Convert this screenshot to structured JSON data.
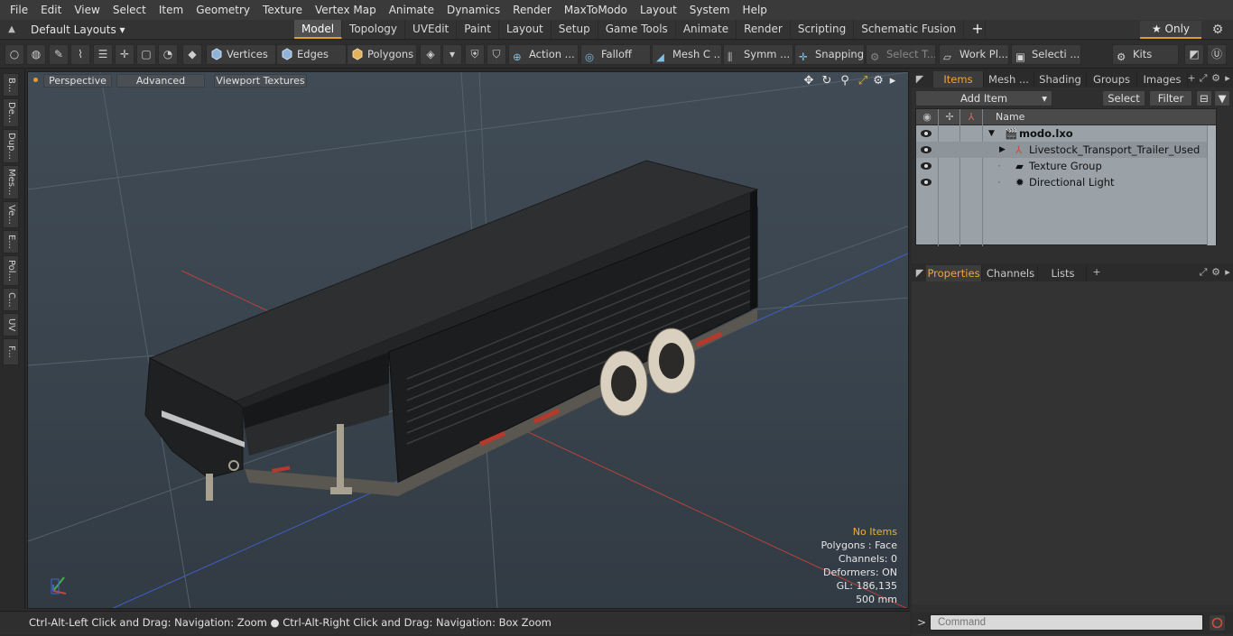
{
  "menu": [
    "File",
    "Edit",
    "View",
    "Select",
    "Item",
    "Geometry",
    "Texture",
    "Vertex Map",
    "Animate",
    "Dynamics",
    "Render",
    "MaxToModo",
    "Layout",
    "System",
    "Help"
  ],
  "layout": {
    "selector": "Default Layouts ▾"
  },
  "tabs": [
    {
      "label": "Model",
      "active": true
    },
    {
      "label": "Topology"
    },
    {
      "label": "UVEdit"
    },
    {
      "label": "Paint"
    },
    {
      "label": "Layout"
    },
    {
      "label": "Setup"
    },
    {
      "label": "Game Tools"
    },
    {
      "label": "Animate"
    },
    {
      "label": "Render"
    },
    {
      "label": "Scripting"
    },
    {
      "label": "Schematic Fusion"
    }
  ],
  "only_label": "★ Only",
  "toolbar": {
    "vertices": "Vertices",
    "edges": "Edges",
    "polygons": "Polygons",
    "action": "Action ...",
    "falloff": "Falloff",
    "mesh": "Mesh C ...",
    "symm": "Symm ...",
    "snapping": "Snapping",
    "select_t": "Select T...",
    "work_pl": "Work Pl...",
    "selecti": "Selecti ...",
    "kits": "Kits"
  },
  "left_tabs": [
    "B...",
    "De...",
    "Dup...",
    "Mes...",
    "Ve...",
    "E...",
    "Pol...",
    "C...",
    "UV",
    "F..."
  ],
  "viewport": {
    "perspective": "Perspective",
    "advanced": "Advanced",
    "viewport_textures": "Viewport Textures",
    "hud": {
      "no_items": "No Items",
      "polygons": "Polygons : Face",
      "channels": "Channels: 0",
      "deformers": "Deformers: ON",
      "gl": "GL: 186,135",
      "scale": "500 mm"
    }
  },
  "status": "Ctrl-Alt-Left Click and Drag: Navigation: Zoom ● Ctrl-Alt-Right Click and Drag: Navigation: Box Zoom",
  "items_panel": {
    "tabs": [
      "Items",
      "Mesh ...",
      "Shading",
      "Groups",
      "Images"
    ],
    "add_item": "Add Item",
    "select": "Select",
    "filter": "Filter",
    "col_name": "Name",
    "rows": [
      {
        "label": "modo.lxo"
      },
      {
        "label": "Livestock_Transport_Trailer_Used"
      },
      {
        "label": "Texture Group"
      },
      {
        "label": "Directional Light"
      }
    ]
  },
  "properties_panel": {
    "tabs": [
      "Properties",
      "Channels",
      "Lists"
    ]
  },
  "command": {
    "placeholder": "Command",
    "prompt": ">"
  },
  "colors": {
    "accent": "#e59a2c",
    "hud_warn": "#e8b13a",
    "list_bg": "#9aa2a8"
  }
}
